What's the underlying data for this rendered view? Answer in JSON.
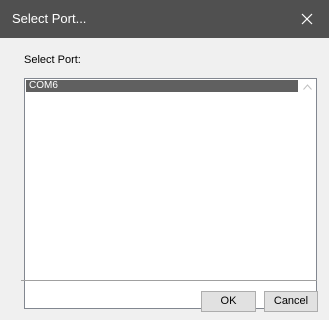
{
  "window": {
    "title": "Select Port...",
    "close_icon": "close-icon"
  },
  "form": {
    "label": "Select Port:",
    "ports": [
      "COM6"
    ],
    "selected_port": "COM6"
  },
  "buttons": {
    "ok_label": "OK",
    "cancel_label": "Cancel"
  },
  "colors": {
    "titlebar": "#505050",
    "selection": "#606060",
    "dialog_bg": "#f0f0f0"
  }
}
